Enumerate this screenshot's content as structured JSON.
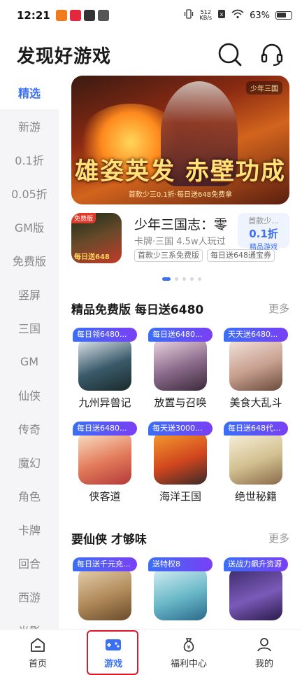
{
  "status_bar": {
    "time": "12:21",
    "speed_value": "512",
    "speed_unit": "KB/s",
    "battery": "63%"
  },
  "header": {
    "title": "发现好游戏",
    "search_icon": "search-icon",
    "support_icon": "headset-icon"
  },
  "sidebar": {
    "items": [
      "精选",
      "新游",
      "0.1折",
      "0.05折",
      "GM版",
      "免费版",
      "竖屏",
      "三国",
      "GM",
      "仙侠",
      "传奇",
      "魔幻",
      "角色",
      "卡牌",
      "回合",
      "西游",
      "光影"
    ],
    "active_index": 0
  },
  "banner": {
    "title": "雄姿英发 赤壁功成",
    "subtitle": "首款少三0.1折·每日送648免费拿",
    "tag": "少年三国"
  },
  "featured": {
    "icon_badge": "免费版",
    "icon_mark": "每日送648",
    "title": "少年三国志：零",
    "meta": "卡牌·三国 4.5w人玩过",
    "chips": [
      "首款少三系免费版",
      "每日送648通宝券"
    ],
    "discount_top": "首款少...",
    "discount_value": "0.1折",
    "discount_label": "精品游戏"
  },
  "pager": {
    "count": 5,
    "active": 0
  },
  "section1": {
    "title": "精品免费版 每日送6480",
    "more": "更多",
    "games": [
      {
        "ribbon": "每日领6480...",
        "name": "九州异兽记"
      },
      {
        "ribbon": "每日送6480...",
        "name": "放置与召唤"
      },
      {
        "ribbon": "天天送6480...",
        "name": "美食大乱斗"
      },
      {
        "ribbon": "每日送6480...",
        "name": "侠客道"
      },
      {
        "ribbon": "每天送3000...",
        "name": "海洋王国"
      },
      {
        "ribbon": "每日送648代...",
        "name": "绝世秘籍"
      }
    ]
  },
  "section2": {
    "title": "要仙侠 才够味",
    "more": "更多",
    "games": [
      {
        "ribbon": "每日送千元充...",
        "name": ""
      },
      {
        "ribbon": "送特权8",
        "name": ""
      },
      {
        "ribbon": "送战力飙升资源",
        "name": ""
      }
    ]
  },
  "bottom_nav": {
    "tabs": [
      {
        "label": "首页",
        "icon": "home-icon"
      },
      {
        "label": "游戏",
        "icon": "gamepad-icon"
      },
      {
        "label": "福利中心",
        "icon": "money-bag-icon"
      },
      {
        "label": "我的",
        "icon": "profile-icon"
      }
    ],
    "active_index": 1
  },
  "colors": {
    "accent": "#3b6ff5",
    "ribbon_start": "#3b6ff5",
    "ribbon_end": "#7a3ff5",
    "highlight": "#e0142a"
  }
}
